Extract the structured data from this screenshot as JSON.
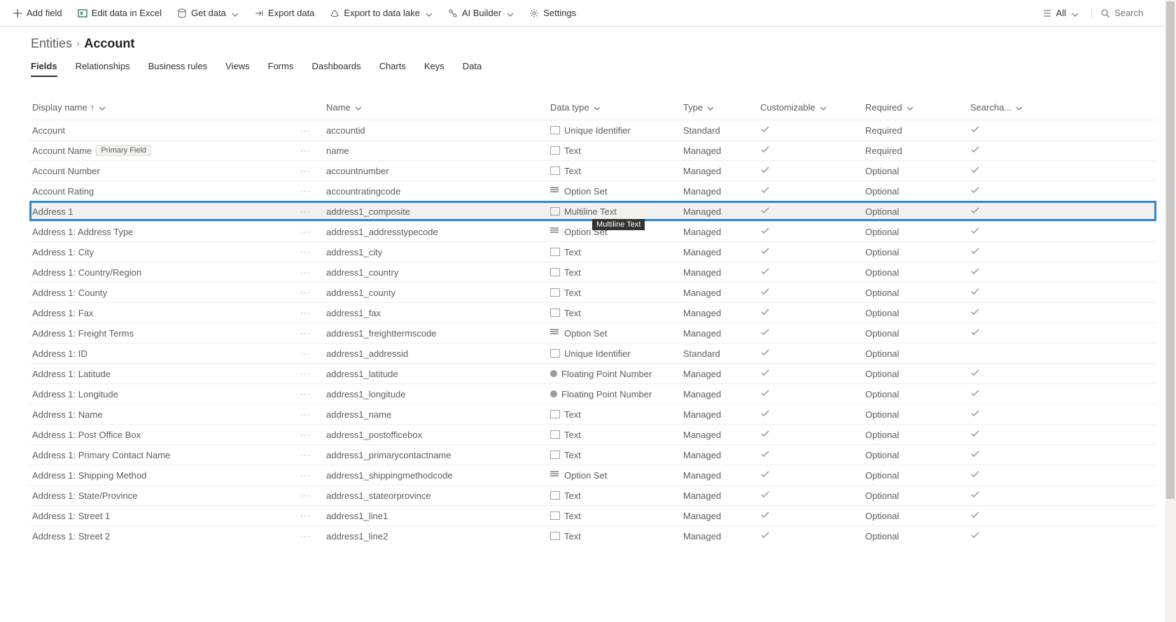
{
  "toolbar": {
    "add_field": "Add field",
    "edit_excel": "Edit data in Excel",
    "get_data": "Get data",
    "export_data": "Export data",
    "export_lake": "Export to data lake",
    "ai_builder": "AI Builder",
    "settings": "Settings",
    "view_filter": "All",
    "search_placeholder": "Search"
  },
  "breadcrumb": {
    "root": "Entities",
    "current": "Account"
  },
  "tabs": [
    "Fields",
    "Relationships",
    "Business rules",
    "Views",
    "Forms",
    "Dashboards",
    "Charts",
    "Keys",
    "Data"
  ],
  "active_tab": 0,
  "columns": {
    "display": "Display name",
    "name": "Name",
    "datatype": "Data type",
    "type": "Type",
    "customizable": "Customizable",
    "required": "Required",
    "searchable": "Searcha..."
  },
  "primary_badge": "Primary Field",
  "selected_index": 4,
  "tooltip_text": "Multiline Text",
  "rows": [
    {
      "display": "Account",
      "name": "accountid",
      "datatype": "Unique Identifier",
      "dticon": "box",
      "type": "Standard",
      "customizable": true,
      "required": "Required",
      "searchable": true,
      "primary": false
    },
    {
      "display": "Account Name",
      "name": "name",
      "datatype": "Text",
      "dticon": "box",
      "type": "Managed",
      "customizable": true,
      "required": "Required",
      "searchable": true,
      "primary": true
    },
    {
      "display": "Account Number",
      "name": "accountnumber",
      "datatype": "Text",
      "dticon": "box",
      "type": "Managed",
      "customizable": true,
      "required": "Optional",
      "searchable": true,
      "primary": false
    },
    {
      "display": "Account Rating",
      "name": "accountratingcode",
      "datatype": "Option Set",
      "dticon": "lines",
      "type": "Managed",
      "customizable": true,
      "required": "Optional",
      "searchable": true,
      "primary": false
    },
    {
      "display": "Address 1",
      "name": "address1_composite",
      "datatype": "Multiline Text",
      "dticon": "box",
      "type": "Managed",
      "customizable": true,
      "required": "Optional",
      "searchable": true,
      "primary": false
    },
    {
      "display": "Address 1: Address Type",
      "name": "address1_addresstypecode",
      "datatype": "Option Set",
      "dticon": "lines",
      "type": "Managed",
      "customizable": true,
      "required": "Optional",
      "searchable": true,
      "primary": false
    },
    {
      "display": "Address 1: City",
      "name": "address1_city",
      "datatype": "Text",
      "dticon": "box",
      "type": "Managed",
      "customizable": true,
      "required": "Optional",
      "searchable": true,
      "primary": false
    },
    {
      "display": "Address 1: Country/Region",
      "name": "address1_country",
      "datatype": "Text",
      "dticon": "box",
      "type": "Managed",
      "customizable": true,
      "required": "Optional",
      "searchable": true,
      "primary": false
    },
    {
      "display": "Address 1: County",
      "name": "address1_county",
      "datatype": "Text",
      "dticon": "box",
      "type": "Managed",
      "customizable": true,
      "required": "Optional",
      "searchable": true,
      "primary": false
    },
    {
      "display": "Address 1: Fax",
      "name": "address1_fax",
      "datatype": "Text",
      "dticon": "box",
      "type": "Managed",
      "customizable": true,
      "required": "Optional",
      "searchable": true,
      "primary": false
    },
    {
      "display": "Address 1: Freight Terms",
      "name": "address1_freighttermscode",
      "datatype": "Option Set",
      "dticon": "lines",
      "type": "Managed",
      "customizable": true,
      "required": "Optional",
      "searchable": true,
      "primary": false
    },
    {
      "display": "Address 1: ID",
      "name": "address1_addressid",
      "datatype": "Unique Identifier",
      "dticon": "box",
      "type": "Standard",
      "customizable": true,
      "required": "Optional",
      "searchable": false,
      "primary": false
    },
    {
      "display": "Address 1: Latitude",
      "name": "address1_latitude",
      "datatype": "Floating Point Number",
      "dticon": "circle",
      "type": "Managed",
      "customizable": true,
      "required": "Optional",
      "searchable": true,
      "primary": false
    },
    {
      "display": "Address 1: Longitude",
      "name": "address1_longitude",
      "datatype": "Floating Point Number",
      "dticon": "circle",
      "type": "Managed",
      "customizable": true,
      "required": "Optional",
      "searchable": true,
      "primary": false
    },
    {
      "display": "Address 1: Name",
      "name": "address1_name",
      "datatype": "Text",
      "dticon": "box",
      "type": "Managed",
      "customizable": true,
      "required": "Optional",
      "searchable": true,
      "primary": false
    },
    {
      "display": "Address 1: Post Office Box",
      "name": "address1_postofficebox",
      "datatype": "Text",
      "dticon": "box",
      "type": "Managed",
      "customizable": true,
      "required": "Optional",
      "searchable": true,
      "primary": false
    },
    {
      "display": "Address 1: Primary Contact Name",
      "name": "address1_primarycontactname",
      "datatype": "Text",
      "dticon": "box",
      "type": "Managed",
      "customizable": true,
      "required": "Optional",
      "searchable": true,
      "primary": false
    },
    {
      "display": "Address 1: Shipping Method",
      "name": "address1_shippingmethodcode",
      "datatype": "Option Set",
      "dticon": "lines",
      "type": "Managed",
      "customizable": true,
      "required": "Optional",
      "searchable": true,
      "primary": false
    },
    {
      "display": "Address 1: State/Province",
      "name": "address1_stateorprovince",
      "datatype": "Text",
      "dticon": "box",
      "type": "Managed",
      "customizable": true,
      "required": "Optional",
      "searchable": true,
      "primary": false
    },
    {
      "display": "Address 1: Street 1",
      "name": "address1_line1",
      "datatype": "Text",
      "dticon": "box",
      "type": "Managed",
      "customizable": true,
      "required": "Optional",
      "searchable": true,
      "primary": false
    },
    {
      "display": "Address 1: Street 2",
      "name": "address1_line2",
      "datatype": "Text",
      "dticon": "box",
      "type": "Managed",
      "customizable": true,
      "required": "Optional",
      "searchable": true,
      "primary": false
    }
  ]
}
